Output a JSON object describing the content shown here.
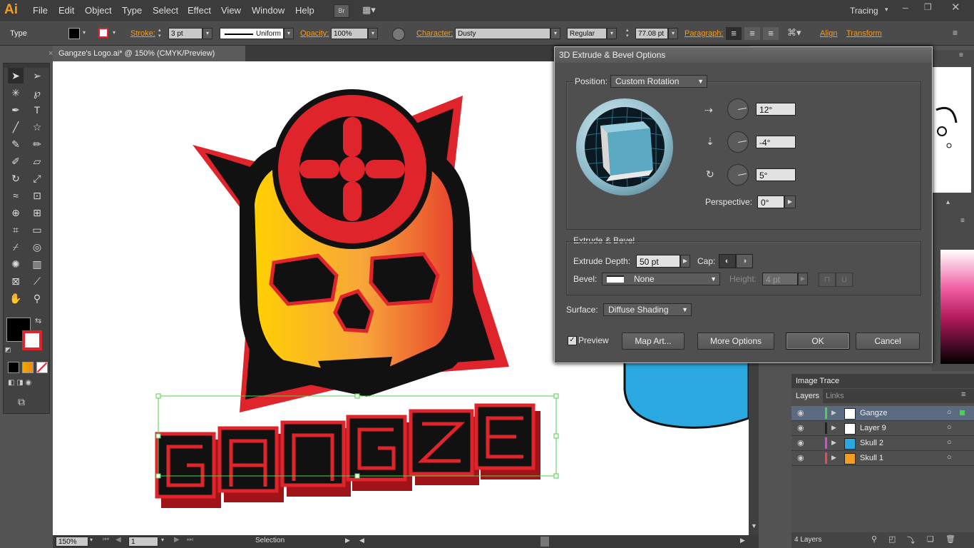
{
  "app": {
    "logo": "Ai",
    "menus": [
      "File",
      "Edit",
      "Object",
      "Type",
      "Select",
      "Effect",
      "View",
      "Window",
      "Help"
    ],
    "bridge_label": "Br",
    "workspace": "Tracing"
  },
  "control_bar": {
    "mode_label": "Type",
    "stroke_label": "Stroke:",
    "stroke_value": "3 pt",
    "profile_value": "Uniform",
    "opacity_label": "Opacity:",
    "opacity_value": "100%",
    "character_label": "Character:",
    "font_value": "Dusty",
    "style_value": "Regular",
    "size_value": "77.08 pt",
    "paragraph_label": "Paragraph:",
    "align_label": "Align",
    "transform_label": "Transform"
  },
  "document": {
    "tab_title": "Gangze's Logo.ai* @ 150% (CMYK/Preview)",
    "logo_text": "Gangze"
  },
  "status_bar": {
    "zoom": "150%",
    "page": "1",
    "tool": "Selection"
  },
  "dialog": {
    "title": "3D Extrude & Bevel Options",
    "position_label": "Position:",
    "position_value": "Custom Rotation",
    "rot_x": "12°",
    "rot_y": "-4°",
    "rot_z": "5°",
    "perspective_label": "Perspective:",
    "perspective_value": "0°",
    "extrude_group": "Extrude & Bevel",
    "extrude_depth_label": "Extrude Depth:",
    "extrude_depth_value": "50 pt",
    "cap_label": "Cap:",
    "bevel_label": "Bevel:",
    "bevel_value": "None",
    "height_label": "Height:",
    "height_value": "4 pt",
    "surface_label": "Surface:",
    "surface_value": "Diffuse Shading",
    "preview_label": "Preview",
    "preview_checked": true,
    "map_art_label": "Map Art...",
    "more_options_label": "More Options",
    "ok_label": "OK",
    "cancel_label": "Cancel"
  },
  "panels": {
    "image_trace_tab": "Image Trace",
    "layers_tab": "Layers",
    "links_tab": "Links",
    "layers": [
      {
        "name": "Gangze",
        "color": "#4fd14f"
      },
      {
        "name": "Layer 9",
        "color": "#222222"
      },
      {
        "name": "Skull 2",
        "color": "#d44fd4"
      },
      {
        "name": "Skull 1",
        "color": "#e04f4f"
      }
    ],
    "layer_count": "4 Layers"
  },
  "colors": {
    "accent": "#f29c22",
    "fill": "#000000",
    "stroke": "#e0242b"
  }
}
